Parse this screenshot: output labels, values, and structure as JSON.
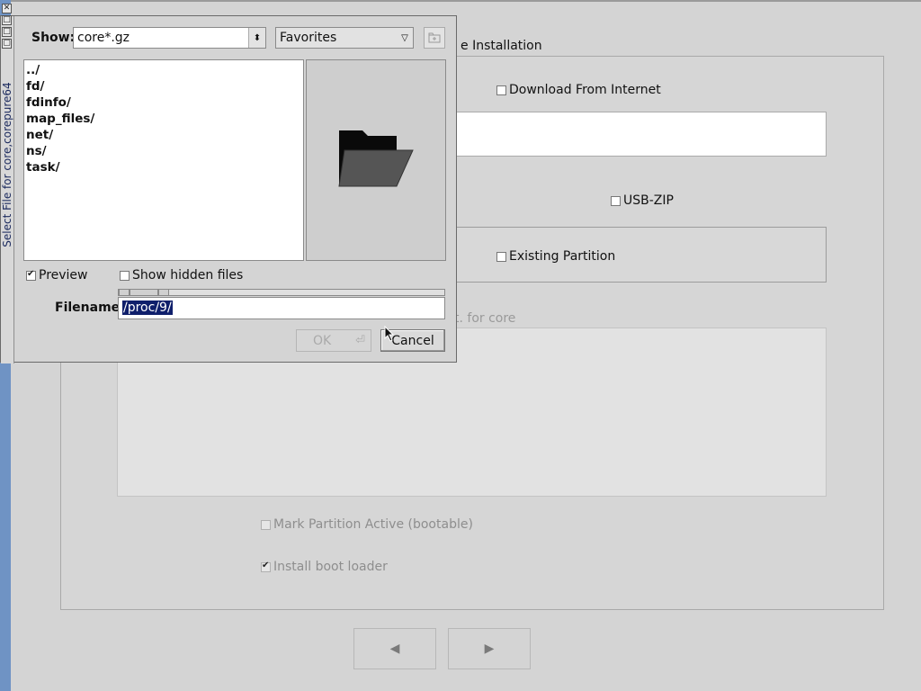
{
  "background": {
    "title": "e Installation",
    "download_label": "Download From Internet",
    "usbzip_label": "USB-ZIP",
    "existing_partition_label": "Existing Partition",
    "bootcode_label": "t. for core",
    "mark_active_label": "Mark Partition Active (bootable)",
    "bootloader_label": "Install boot loader",
    "back_glyph": "◀",
    "next_glyph": "▶"
  },
  "dialog": {
    "side_title": "Select File for core,corepure64",
    "show_label": "Show:",
    "filter_value": "core*.gz",
    "favorites_value": "Favorites",
    "files": [
      "../",
      "fd/",
      "fdinfo/",
      "map_files/",
      "net/",
      "ns/",
      "task/"
    ],
    "preview_label": "Preview",
    "hidden_label": "Show hidden files",
    "filename_label": "Filename:",
    "filename_value": "/proc/9/",
    "ok_label": "OK",
    "cancel_label": "Cancel"
  },
  "icons": {
    "preview": "folder-icon",
    "new_folder": "new-folder-icon",
    "enter": "enter-icon"
  },
  "colors": {
    "selection": "#0f1f6b",
    "frame": "#6f93c4"
  }
}
